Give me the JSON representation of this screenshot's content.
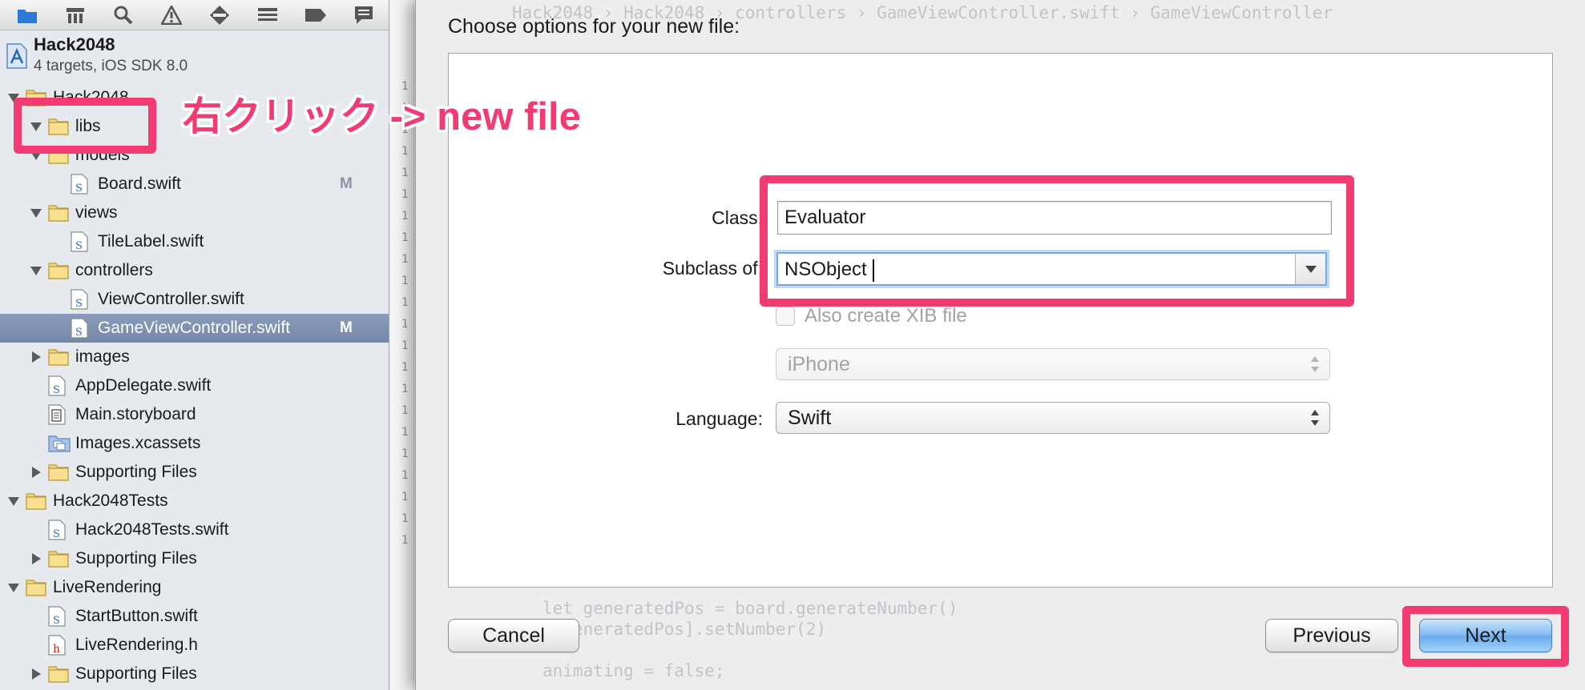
{
  "navigator": {
    "toolbar_icons": [
      "folder-icon",
      "hierarchy-icon",
      "search-icon",
      "warning-icon",
      "breakpoint-icon",
      "list-icon",
      "tag-icon",
      "log-icon"
    ],
    "project": {
      "name": "Hack2048",
      "subtitle": "4 targets, iOS SDK 8.0"
    },
    "tree": [
      {
        "label": "Hack2048",
        "type": "folder",
        "depth": 0,
        "expanded": true,
        "badge": "",
        "selected": false
      },
      {
        "label": "libs",
        "type": "folder",
        "depth": 1,
        "expanded": true,
        "badge": "",
        "selected": false
      },
      {
        "label": "models",
        "type": "folder",
        "depth": 1,
        "expanded": true,
        "badge": "",
        "selected": false
      },
      {
        "label": "Board.swift",
        "type": "swift",
        "depth": 2,
        "badge": "M",
        "selected": false
      },
      {
        "label": "views",
        "type": "folder",
        "depth": 1,
        "expanded": true,
        "badge": "",
        "selected": false
      },
      {
        "label": "TileLabel.swift",
        "type": "swift",
        "depth": 2,
        "badge": "",
        "selected": false
      },
      {
        "label": "controllers",
        "type": "folder",
        "depth": 1,
        "expanded": true,
        "badge": "",
        "selected": false
      },
      {
        "label": "ViewController.swift",
        "type": "swift",
        "depth": 2,
        "badge": "",
        "selected": false
      },
      {
        "label": "GameViewController.swift",
        "type": "swift",
        "depth": 2,
        "badge": "M",
        "selected": true
      },
      {
        "label": "images",
        "type": "folder",
        "depth": 1,
        "expanded": false,
        "badge": "",
        "selected": false
      },
      {
        "label": "AppDelegate.swift",
        "type": "swift",
        "depth": 1,
        "badge": "",
        "selected": false
      },
      {
        "label": "Main.storyboard",
        "type": "storyboard",
        "depth": 1,
        "badge": "",
        "selected": false
      },
      {
        "label": "Images.xcassets",
        "type": "assets",
        "depth": 1,
        "badge": "",
        "selected": false
      },
      {
        "label": "Supporting Files",
        "type": "folder",
        "depth": 1,
        "expanded": false,
        "badge": "",
        "selected": false
      },
      {
        "label": "Hack2048Tests",
        "type": "folder",
        "depth": 0,
        "expanded": true,
        "badge": "",
        "selected": false
      },
      {
        "label": "Hack2048Tests.swift",
        "type": "swift",
        "depth": 1,
        "badge": "",
        "selected": false
      },
      {
        "label": "Supporting Files",
        "type": "folder",
        "depth": 1,
        "expanded": false,
        "badge": "",
        "selected": false
      },
      {
        "label": "LiveRendering",
        "type": "folder",
        "depth": 0,
        "expanded": true,
        "badge": "",
        "selected": false
      },
      {
        "label": "StartButton.swift",
        "type": "swift",
        "depth": 1,
        "badge": "",
        "selected": false
      },
      {
        "label": "LiveRendering.h",
        "type": "header",
        "depth": 1,
        "badge": "",
        "selected": false
      },
      {
        "label": "Supporting Files",
        "type": "folder",
        "depth": 1,
        "expanded": false,
        "badge": "",
        "selected": false
      }
    ]
  },
  "editor": {
    "breadcrumb_ghost": "Hack2048 › Hack2048 › controllers › GameViewController.swift › GameViewController",
    "code_ghost": [
      "let generatedPos = board.generateNumber()",
      "s[generatedPos].setNumber(2)",
      "animating = false;"
    ]
  },
  "annotation": {
    "text": "右クリック -> new file",
    "color": "#f33b73"
  },
  "dialog": {
    "title": "Choose options for your new file:",
    "fields": {
      "class_label": "Class:",
      "class_value": "Evaluator",
      "subclass_label": "Subclass of:",
      "subclass_value": "NSObject",
      "xib_label": "Also create XIB file",
      "xib_checked": false,
      "device_value": "iPhone",
      "language_label": "Language:",
      "language_value": "Swift"
    },
    "buttons": {
      "cancel": "Cancel",
      "previous": "Previous",
      "next": "Next"
    }
  },
  "colors": {
    "highlight": "#f33b73",
    "selection": "#7c8fb0",
    "default_button": "#7db8f0"
  }
}
